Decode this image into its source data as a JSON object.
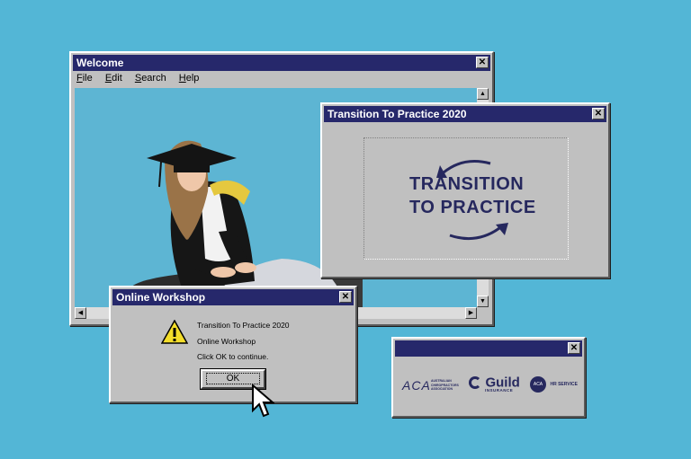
{
  "welcome_window": {
    "title": "Welcome",
    "close_glyph": "✕",
    "menu": [
      "File",
      "Edit",
      "Search",
      "Help"
    ]
  },
  "ttp_window": {
    "title": "Transition To Practice 2020",
    "close_glyph": "✕",
    "logo_line1": "TRANSITION",
    "logo_line2": "TO PRACTICE"
  },
  "workshop_dialog": {
    "title": "Online Workshop",
    "close_glyph": "✕",
    "icon": "warning-icon",
    "line1": "Transition To Practice 2020",
    "line2": "Online Workshop",
    "line3": "Click OK to continue.",
    "ok_label": "OK"
  },
  "sponsors_window": {
    "close_glyph": "✕",
    "aca_mark": "ACA",
    "aca_text": "AUSTRALIAN CHIROPRACTORS ASSOCIATION",
    "guild_name": "Guild",
    "guild_sub": "INSURANCE",
    "hr_mark": "ACA",
    "hr_text": "HR SERVICE"
  },
  "colors": {
    "background": "#53b6d6",
    "titlebar": "#26286b",
    "window": "#c0c0c0",
    "logo": "#26285e"
  }
}
